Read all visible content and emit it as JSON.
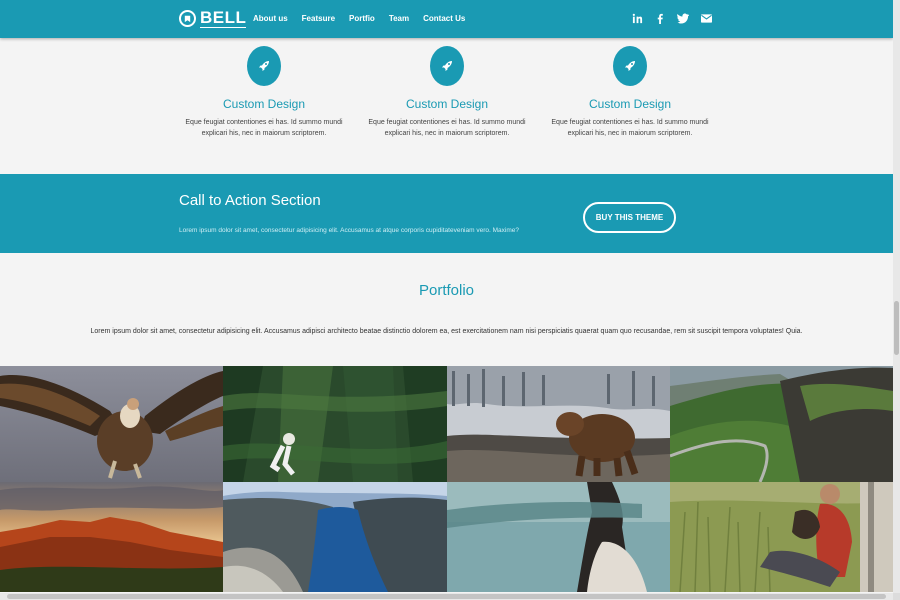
{
  "brand": {
    "name": "BELL"
  },
  "nav": {
    "links": [
      "About us",
      "Featsure",
      "Portfio",
      "Team",
      "Contact Us"
    ]
  },
  "social": {
    "icons": [
      "linkedin-icon",
      "facebook-icon",
      "twitter-icon",
      "envelope-icon"
    ]
  },
  "features": [
    {
      "title": "Custom Design",
      "text": "Eque feugiat contentiones ei has. Id summo mundi explicari his, nec in maiorum scriptorem.",
      "icon": "rocket-icon"
    },
    {
      "title": "Custom Design",
      "text": "Eque feugiat contentiones ei has. Id summo mundi explicari his, nec in maiorum scriptorem.",
      "icon": "rocket-icon"
    },
    {
      "title": "Custom Design",
      "text": "Eque feugiat contentiones ei has. Id summo mundi explicari his, nec in maiorum scriptorem.",
      "icon": "rocket-icon"
    }
  ],
  "cta": {
    "title": "Call to Action Section",
    "text": "Lorem ipsum dolor sit amet, consectetur adipisicing elit. Accusamus at atque corporis cupiditateveniam vero. Maxime?",
    "button": "BUY THIS THEME"
  },
  "portfolio": {
    "title": "Portfolio",
    "text": "Lorem ipsum dolor sit amet, consectetur adipisicing elit. Accusamus adipisci architecto beatae distinctio dolorem ea, est exercitationem nam nisi perspiciatis quaerat quam quo recusandae, rem sit suscipit tempora voluptates! Quia.",
    "images": [
      "vulture",
      "forest-climber",
      "bear",
      "green-cliffs",
      "red-canyon",
      "blue-fjord",
      "blindfolded-woman",
      "man-with-dog"
    ]
  },
  "colors": {
    "primary": "#1a9ab3",
    "background": "#f4f4f4"
  }
}
